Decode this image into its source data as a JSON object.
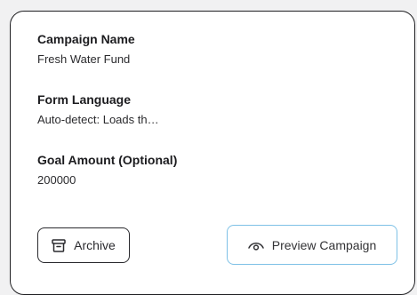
{
  "campaign": {
    "name_label": "Campaign Name",
    "name_value": "Fresh Water Fund",
    "language_label": "Form Language",
    "language_value": "Auto-detect: Loads th…",
    "goal_label": "Goal Amount (Optional)",
    "goal_value": "200000"
  },
  "actions": {
    "archive_label": "Archive",
    "archive_icon": "archive-box-icon",
    "preview_label": "Preview Campaign",
    "preview_icon": "eye-icon"
  },
  "colors": {
    "card_border": "#1f1f22",
    "preview_border": "#7ec1e6",
    "background": "#f1f1f2"
  }
}
